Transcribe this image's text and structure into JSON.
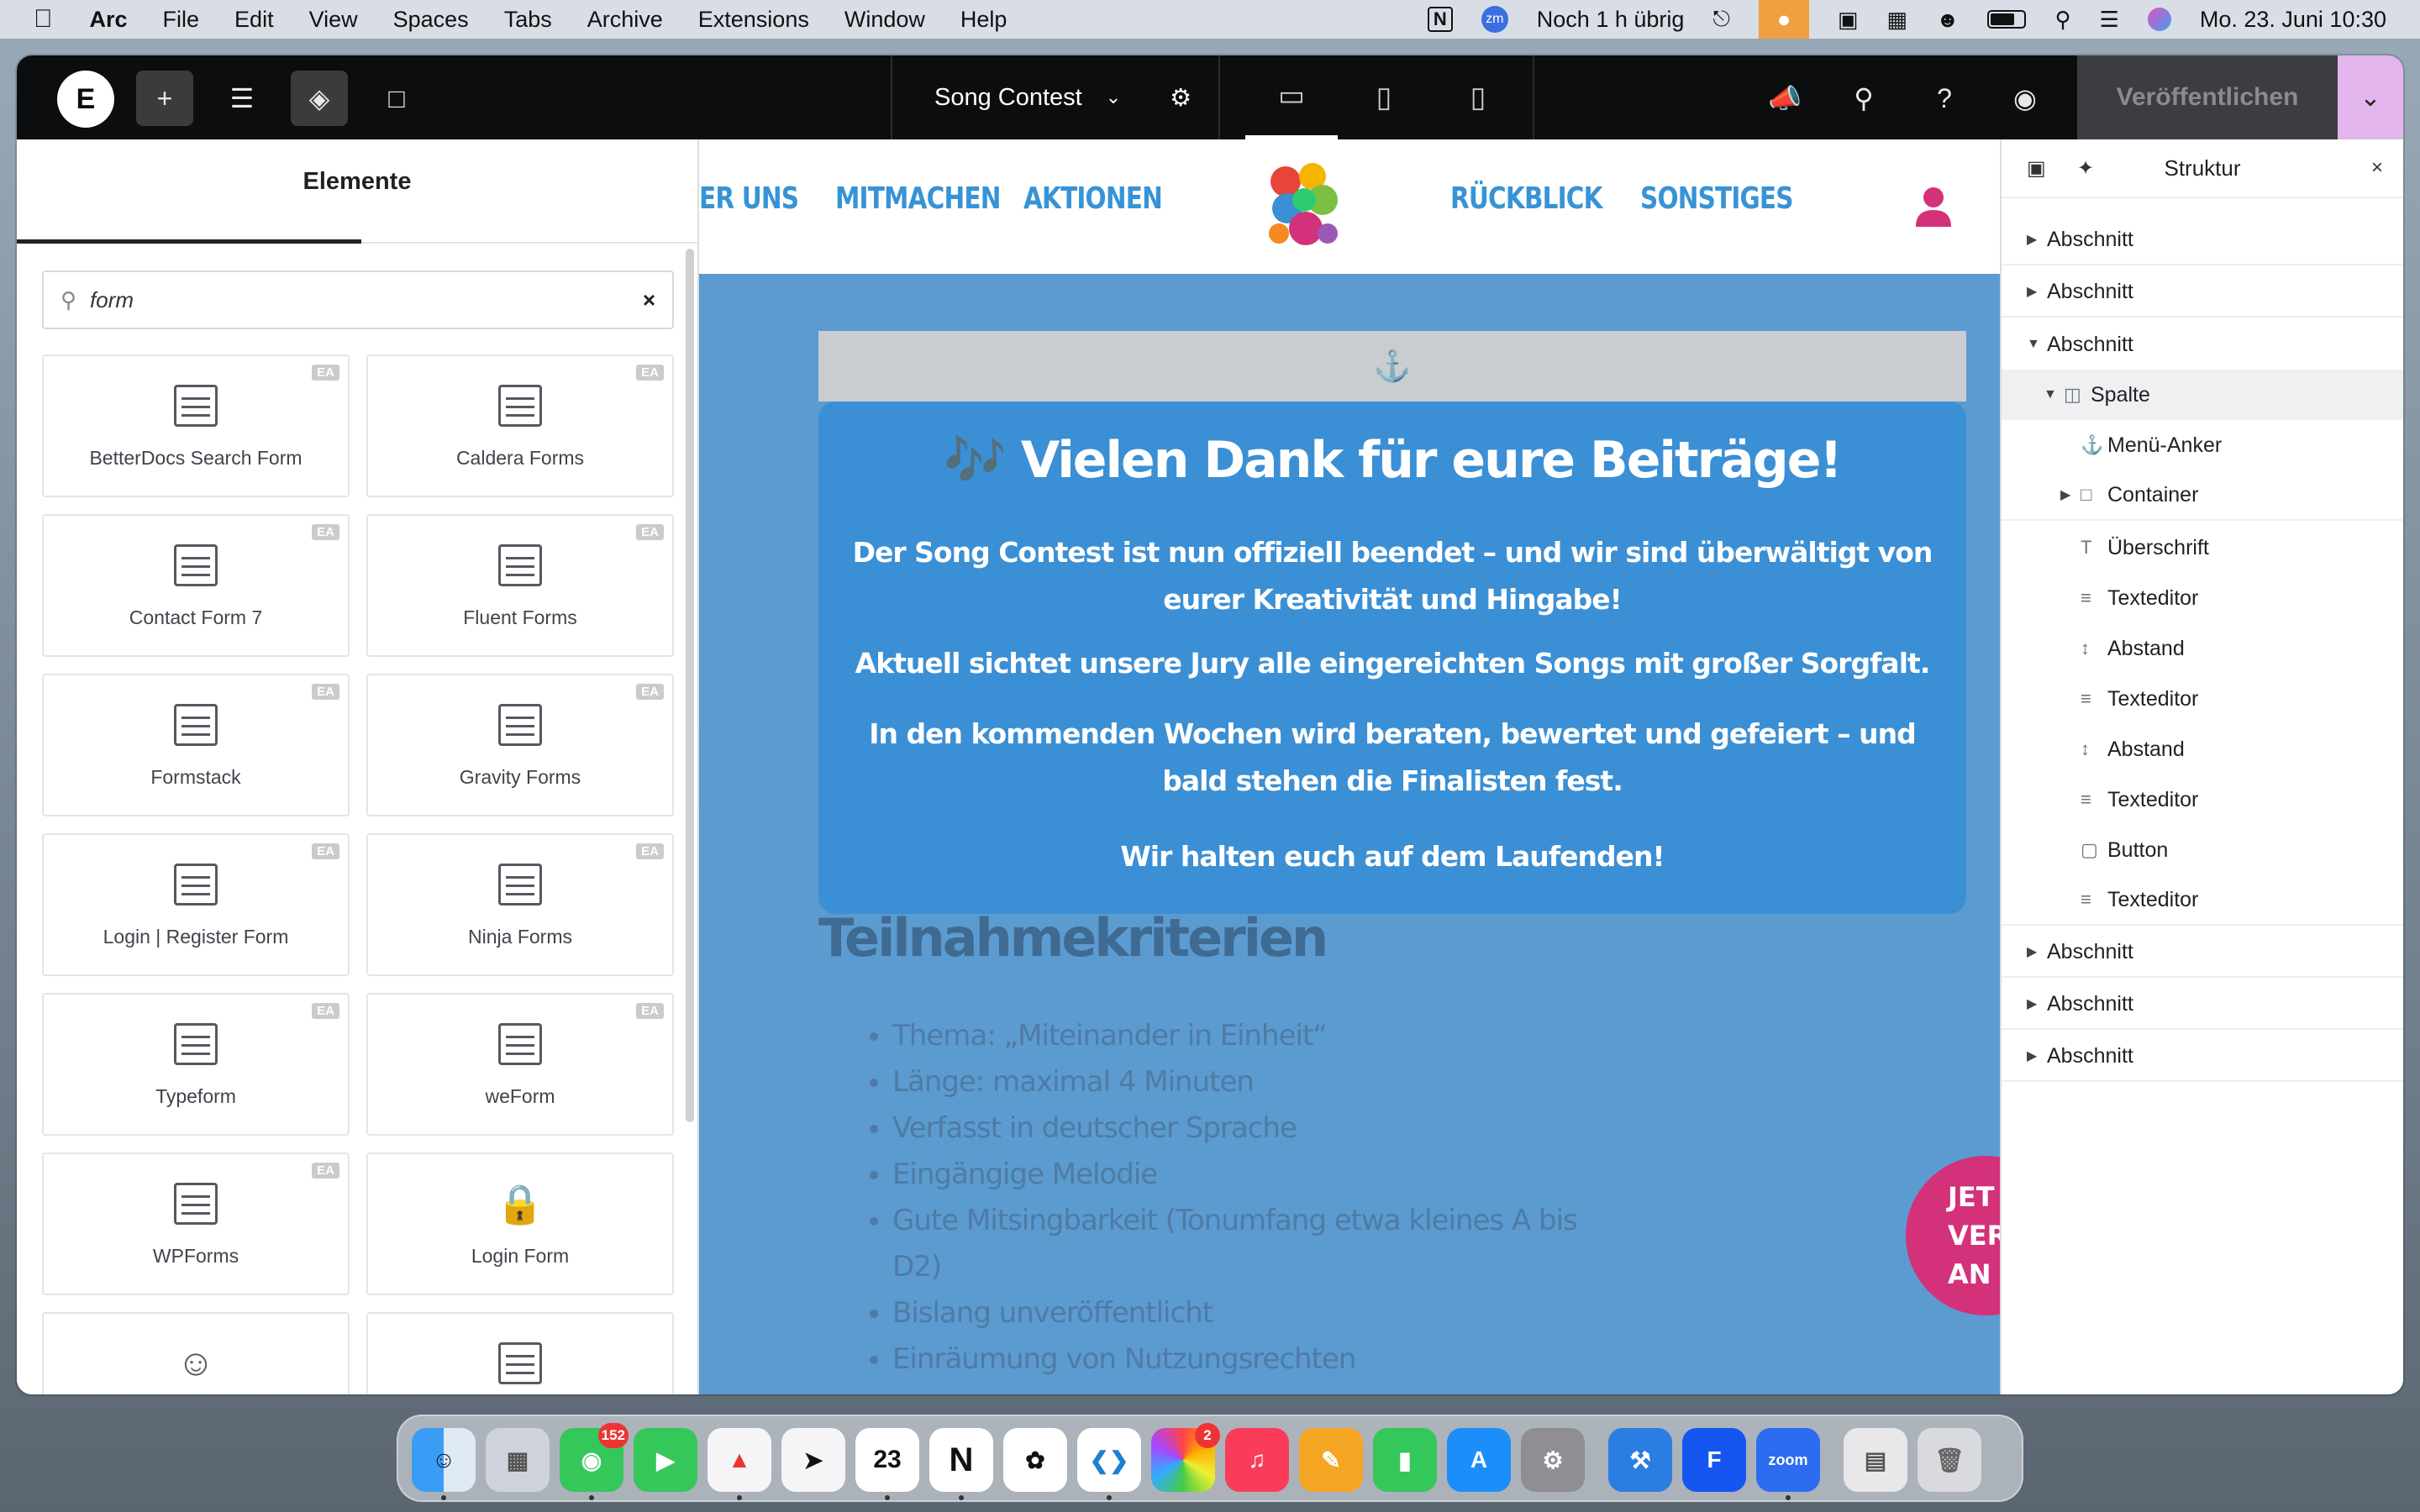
{
  "menubar": {
    "app": "Arc",
    "items": [
      "File",
      "Edit",
      "View",
      "Spaces",
      "Tabs",
      "Archive",
      "Extensions",
      "Window",
      "Help"
    ],
    "battery_text": "Noch 1 h übrig",
    "datetime": "Mo. 23. Juni  10:30"
  },
  "editor": {
    "doc_title": "Song Contest",
    "publish_label": "Veröffentlichen"
  },
  "left_panel": {
    "title": "Elemente",
    "search_value": "form",
    "widgets": [
      {
        "label": "BetterDocs Search Form",
        "badge": "EA"
      },
      {
        "label": "Caldera Forms",
        "badge": "EA"
      },
      {
        "label": "Contact Form 7",
        "badge": "EA"
      },
      {
        "label": "Fluent Forms",
        "badge": "EA"
      },
      {
        "label": "Formstack",
        "badge": "EA"
      },
      {
        "label": "Gravity Forms",
        "badge": "EA"
      },
      {
        "label": "Login | Register Form",
        "badge": "EA"
      },
      {
        "label": "Ninja Forms",
        "badge": "EA"
      },
      {
        "label": "Typeform",
        "badge": "EA"
      },
      {
        "label": "weForm",
        "badge": "EA"
      },
      {
        "label": "WPForms",
        "badge": "EA"
      },
      {
        "label": "Login Form",
        "badge": ""
      }
    ]
  },
  "site": {
    "nav": [
      "ER UNS",
      "MITMACHEN",
      "AKTIONEN",
      "RÜCKBLICK",
      "SONSTIGES"
    ],
    "box_title": "🎶 Vielen Dank für eure Beiträge!",
    "box_p1": "Der Song Contest ist nun offiziell beendet – und wir sind überwältigt von eurer Kreativität und Hingabe!",
    "box_p2": "Aktuell sichtet unsere Jury alle eingereichten Songs mit großer Sorgfalt.",
    "box_p3": "In den kommenden Wochen wird beraten, bewertet und gefeiert – und bald stehen die Finalisten fest.",
    "box_p4": "Wir halten euch auf dem Laufenden!",
    "criteria_title": "Teilnahmekriterien",
    "criteria": [
      "Thema: „Miteinander in Einheit“",
      "Länge: maximal 4 Minuten",
      "Verfasst in deutscher Sprache",
      "Eingängige Melodie",
      "Gute Mitsingbarkeit (Tonumfang etwa kleines A bis D2)",
      "Bislang unveröffentlicht",
      "Einräumung von Nutzungsrechten"
    ],
    "cta_lines": [
      "JET",
      "VERA",
      "AN"
    ]
  },
  "structure": {
    "title": "Struktur",
    "items": [
      {
        "label": "Abschnitt"
      },
      {
        "label": "Abschnitt"
      },
      {
        "label": "Abschnitt"
      },
      {
        "label": "Spalte"
      },
      {
        "label": "Menü-Anker"
      },
      {
        "label": "Container"
      },
      {
        "label": "Überschrift"
      },
      {
        "label": "Texteditor"
      },
      {
        "label": "Abstand"
      },
      {
        "label": "Texteditor"
      },
      {
        "label": "Abstand"
      },
      {
        "label": "Texteditor"
      },
      {
        "label": "Button"
      },
      {
        "label": "Texteditor"
      },
      {
        "label": "Abschnitt"
      },
      {
        "label": "Abschnitt"
      },
      {
        "label": "Abschnitt"
      }
    ]
  },
  "dock": {
    "messages_badge": "152",
    "photos_badge": "2",
    "calendar_day": "23",
    "zoom_label": "zoom"
  },
  "colors": {
    "accent_blue": "#3b8fd4",
    "nav_blue": "#3793d6",
    "cta_pink": "#d3317a",
    "publish_arrow": "#e2b6ec"
  }
}
